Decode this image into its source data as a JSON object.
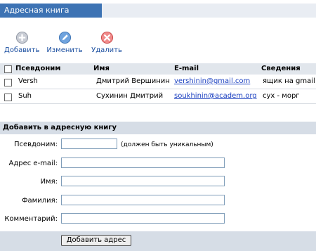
{
  "title": "Адресная книга",
  "toolbar": {
    "add": "Добавить",
    "edit": "Изменить",
    "delete": "Удалить"
  },
  "table": {
    "columns": [
      "Псевдоним",
      "Имя",
      "E-mail",
      "Сведения"
    ],
    "rows": [
      {
        "alias": "Versh",
        "name": "Дмитрий Вершинин",
        "email": "vershinin@gmail.com",
        "info": "ящик на gmail"
      },
      {
        "alias": "Suh",
        "name": "Сухинин Дмитрий",
        "email": "soukhinin@academ.org",
        "info": "сух - морг"
      }
    ]
  },
  "form": {
    "heading": "Добавить в адресную книгу",
    "alias_label": "Псевдоним:",
    "alias_hint": "(должен быть уникальным)",
    "email_label": "Адрес e-mail:",
    "name_label": "Имя:",
    "surname_label": "Фамилия:",
    "comment_label": "Комментарий:",
    "submit": "Добавить адрес"
  },
  "colors": {
    "accent": "#3d73b4",
    "link": "#1a3fc0",
    "header_bg": "#e1e6ec",
    "section_bg": "#d6dde6"
  }
}
